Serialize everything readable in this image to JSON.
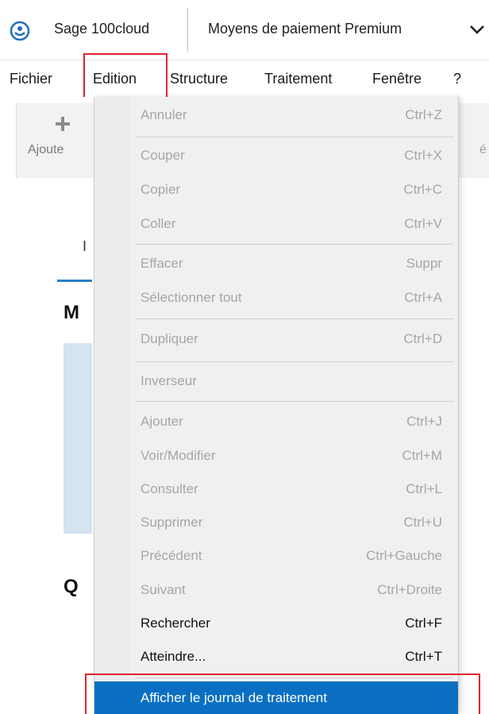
{
  "app": {
    "name": "Sage 100cloud",
    "document_title": "Moyens de paiement Premium",
    "logo_icon": "sage-logo-icon",
    "chevron_icon": "chevron-down-icon"
  },
  "menubar": {
    "items": [
      "Fichier",
      "Edition",
      "Structure",
      "Traitement",
      "Fenêtre",
      "?"
    ],
    "active": "Edition"
  },
  "background": {
    "toolbar_label": "Ajoute",
    "toolbar_right_glyph": "é",
    "tab_fragment": "I",
    "heading_1": "M",
    "heading_2": "Q"
  },
  "edit_menu": {
    "items": [
      {
        "label": "Annuler",
        "shortcut": "Ctrl+Z",
        "enabled": false
      },
      {
        "label": "Couper",
        "shortcut": "Ctrl+X",
        "enabled": false
      },
      {
        "label": "Copier",
        "shortcut": "Ctrl+C",
        "enabled": false
      },
      {
        "label": "Coller",
        "shortcut": "Ctrl+V",
        "enabled": false
      },
      {
        "label": "Effacer",
        "shortcut": "Suppr",
        "enabled": false
      },
      {
        "label": "Sélectionner tout",
        "shortcut": "Ctrl+A",
        "enabled": false
      },
      {
        "label": "Dupliquer",
        "shortcut": "Ctrl+D",
        "enabled": false
      },
      {
        "label": "Inverseur",
        "shortcut": "",
        "enabled": false
      },
      {
        "label": "Ajouter",
        "shortcut": "Ctrl+J",
        "enabled": false
      },
      {
        "label": "Voir/Modifier",
        "shortcut": "Ctrl+M",
        "enabled": false
      },
      {
        "label": "Consulter",
        "shortcut": "Ctrl+L",
        "enabled": false
      },
      {
        "label": "Supprimer",
        "shortcut": "Ctrl+U",
        "enabled": false
      },
      {
        "label": "Précédent",
        "shortcut": "Ctrl+Gauche",
        "enabled": false
      },
      {
        "label": "Suivant",
        "shortcut": "Ctrl+Droite",
        "enabled": false
      },
      {
        "label": "Rechercher",
        "shortcut": "Ctrl+F",
        "enabled": true
      },
      {
        "label": "Atteindre...",
        "shortcut": "Ctrl+T",
        "enabled": true
      },
      {
        "label": "Afficher le journal de traitement",
        "shortcut": "",
        "enabled": true,
        "selected": true
      }
    ]
  },
  "colors": {
    "selection": "#0a6fc2",
    "highlight_frame": "#e0242b",
    "disabled_text": "#a6a6a6"
  }
}
